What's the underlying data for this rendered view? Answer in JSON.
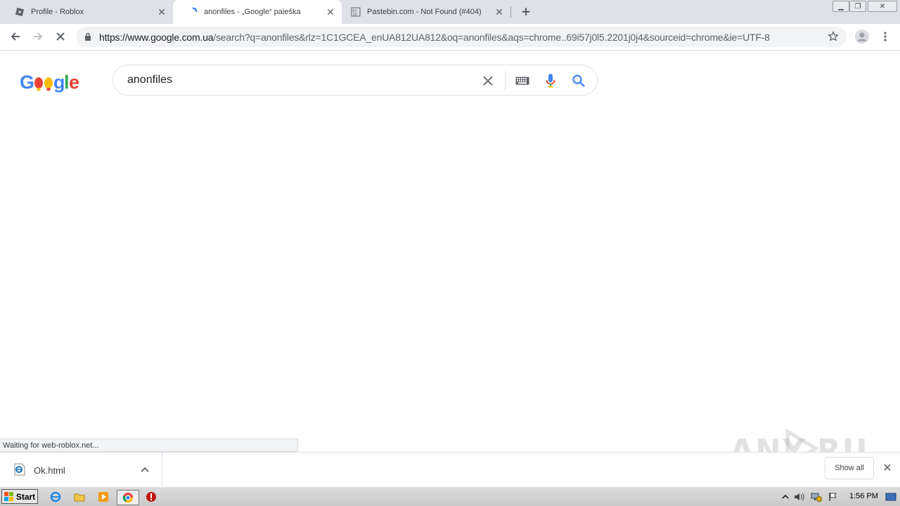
{
  "tabs": [
    {
      "title": "Profile - Roblox",
      "favicon": "roblox-icon"
    },
    {
      "title": "anonfiles - „Google“ paieška",
      "favicon": "loading-spinner-icon",
      "active": true
    },
    {
      "title": "Pastebin.com - Not Found (#404)",
      "favicon": "pastebin-icon"
    }
  ],
  "toolbar": {
    "url_host": "https://www.google.com.ua",
    "url_rest": "/search?q=anonfiles&rlz=1C1GCEA_enUA812UA812&oq=anonfiles&aqs=chrome..69i57j0l5.2201j0j4&sourceid=chrome&ie=UTF-8"
  },
  "google": {
    "logo_text": "Google",
    "search_value": "anonfiles"
  },
  "status": {
    "text": "Waiting for web-roblox.net..."
  },
  "downloads": {
    "file_name": "Ok.html",
    "show_all_label": "Show all"
  },
  "watermark": "ANY RUN",
  "taskbar": {
    "start_label": "Start",
    "clock": "1:56 PM"
  },
  "colors": {
    "google_blue": "#4285f4",
    "google_red": "#ea4335",
    "google_yellow": "#fbbc05",
    "google_green": "#34a853"
  }
}
